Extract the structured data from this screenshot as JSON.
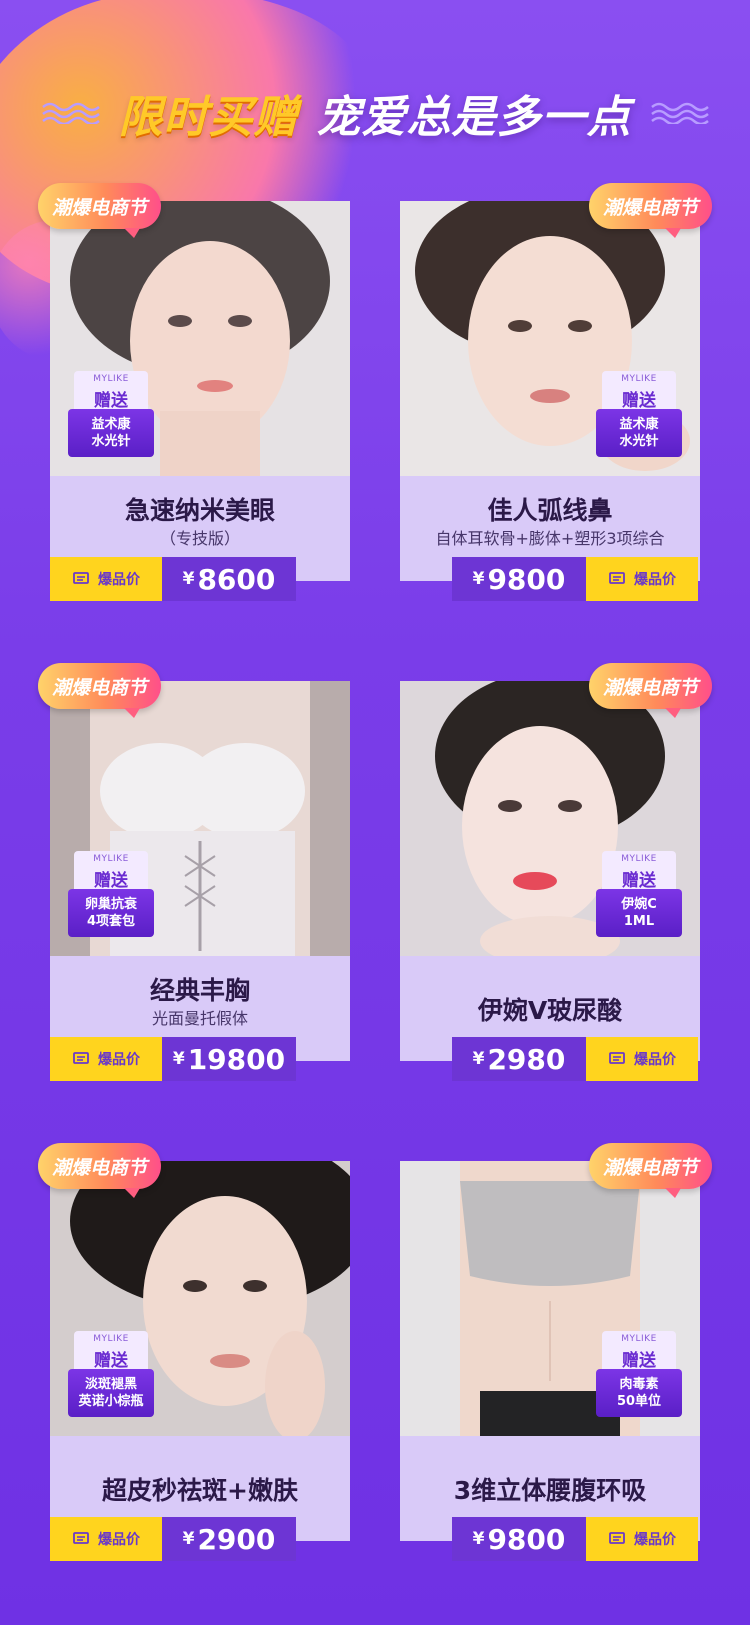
{
  "header": {
    "title_yellow": "限时买赠",
    "title_white": "宠爱总是多一点"
  },
  "colors": {
    "bg": "#7a3de9",
    "flag_yellow": "#ffd41e",
    "price_purple": "#6d35d4",
    "card": "#d9caf8"
  },
  "gift_brand": "MYLIKE",
  "gift_label": "赠送",
  "hot_label": "爆品价",
  "currency": "¥",
  "cards": [
    {
      "tag": "潮爆电商节",
      "title": "急速纳米美眼",
      "subtitle": "（专技版）",
      "gift_line1": "益术康",
      "gift_line2": "水光针",
      "price": "8600"
    },
    {
      "tag": "潮爆电商节",
      "title": "佳人弧线鼻",
      "subtitle": "自体耳软骨+膨体+塑形3项综合",
      "gift_line1": "益术康",
      "gift_line2": "水光针",
      "price": "9800"
    },
    {
      "tag": "潮爆电商节",
      "title": "经典丰胸",
      "subtitle": "光面曼托假体",
      "gift_line1": "卵巢抗衰",
      "gift_line2": "4项套包",
      "price": "19800"
    },
    {
      "tag": "潮爆电商节",
      "title": "伊婉V玻尿酸",
      "subtitle": "",
      "gift_line1": "伊婉C",
      "gift_line2": "1ML",
      "price": "2980"
    },
    {
      "tag": "潮爆电商节",
      "title": "超皮秒祛斑+嫩肤",
      "subtitle": "",
      "gift_line1": "淡斑褪黑",
      "gift_line2": "英诺小棕瓶",
      "price": "2900"
    },
    {
      "tag": "潮爆电商节",
      "title": "3维立体腰腹环吸",
      "subtitle": "",
      "gift_line1": "肉毒素",
      "gift_line2": "50单位",
      "price": "9800"
    }
  ]
}
